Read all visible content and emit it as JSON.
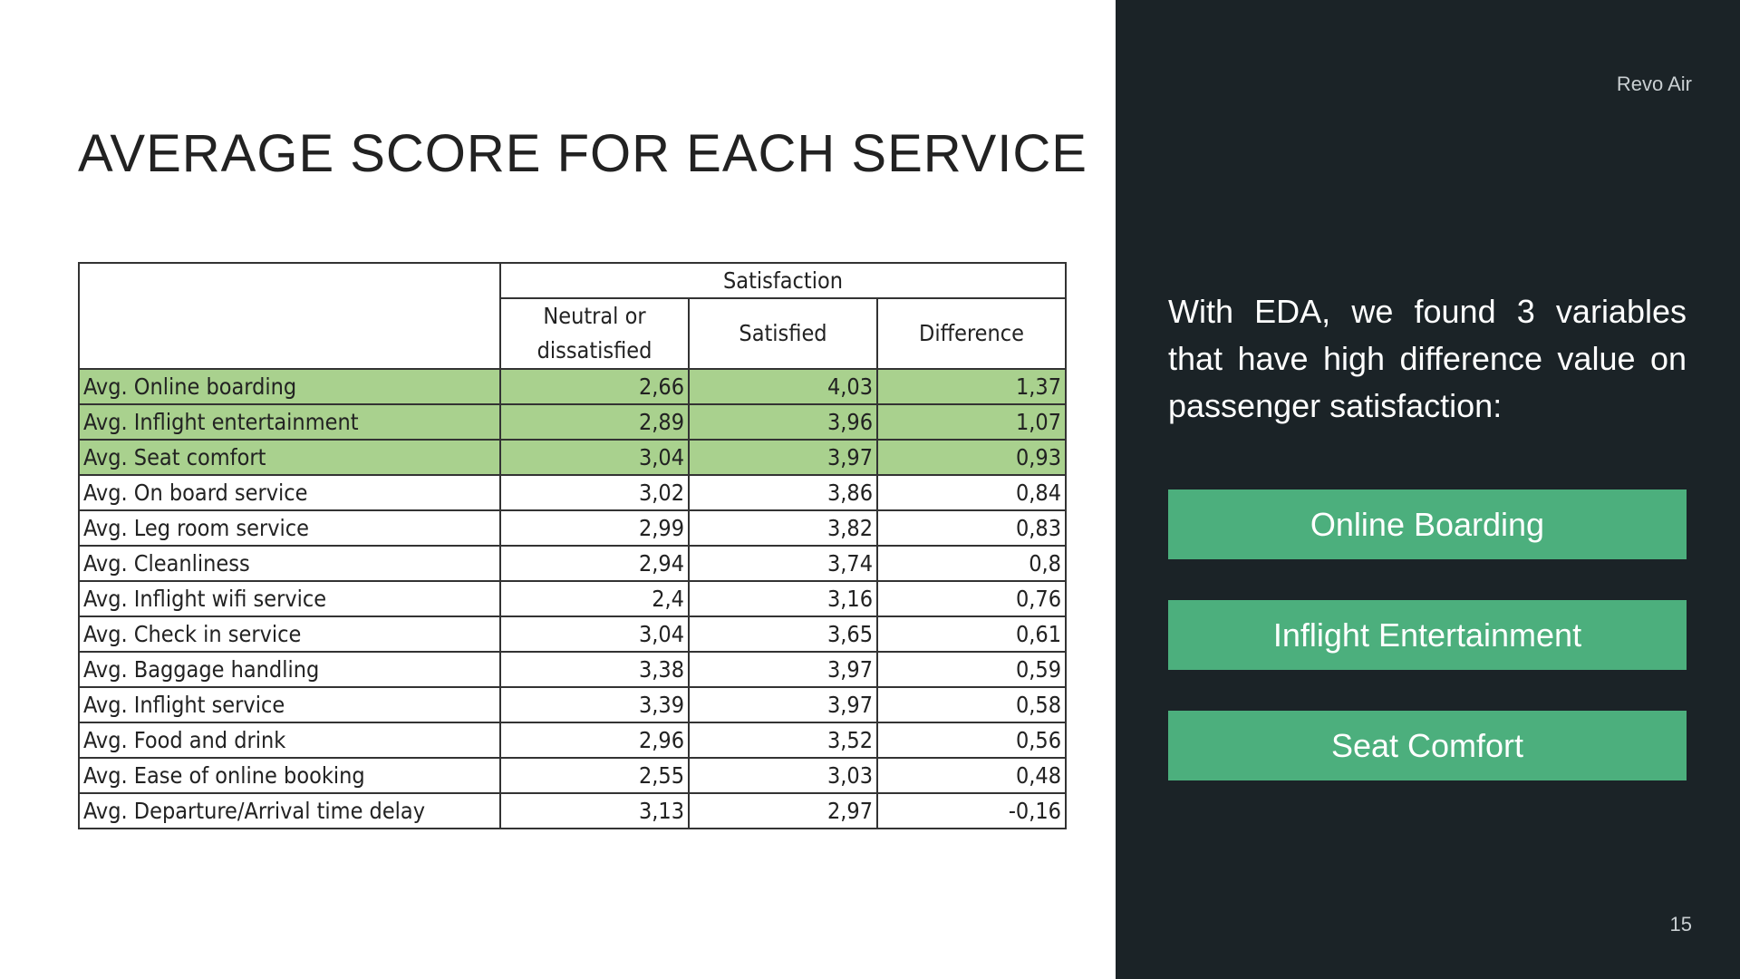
{
  "slide": {
    "title": "AVERAGE SCORE FOR EACH SERVICE",
    "brand": "Revo Air",
    "page_number": "15"
  },
  "table": {
    "group_header": "Satisfaction",
    "columns": [
      "Neutral or dissatisfied",
      "Satisfied",
      "Difference"
    ],
    "highlight_color": "#a9d18e",
    "rows": [
      {
        "label": "Avg. Online boarding",
        "neutral": "2,66",
        "satisfied": "4,03",
        "difference": "1,37",
        "highlighted": true
      },
      {
        "label": "Avg. Inflight entertainment",
        "neutral": "2,89",
        "satisfied": "3,96",
        "difference": "1,07",
        "highlighted": true
      },
      {
        "label": "Avg. Seat comfort",
        "neutral": "3,04",
        "satisfied": "3,97",
        "difference": "0,93",
        "highlighted": true
      },
      {
        "label": "Avg. On board service",
        "neutral": "3,02",
        "satisfied": "3,86",
        "difference": "0,84",
        "highlighted": false
      },
      {
        "label": "Avg. Leg room service",
        "neutral": "2,99",
        "satisfied": "3,82",
        "difference": "0,83",
        "highlighted": false
      },
      {
        "label": "Avg. Cleanliness",
        "neutral": "2,94",
        "satisfied": "3,74",
        "difference": "0,8",
        "highlighted": false
      },
      {
        "label": "Avg. Inflight wifi service",
        "neutral": "2,4",
        "satisfied": "3,16",
        "difference": "0,76",
        "highlighted": false
      },
      {
        "label": "Avg. Check in service",
        "neutral": "3,04",
        "satisfied": "3,65",
        "difference": "0,61",
        "highlighted": false
      },
      {
        "label": "Avg. Baggage handling",
        "neutral": "3,38",
        "satisfied": "3,97",
        "difference": "0,59",
        "highlighted": false
      },
      {
        "label": "Avg. Inflight service",
        "neutral": "3,39",
        "satisfied": "3,97",
        "difference": "0,58",
        "highlighted": false
      },
      {
        "label": "Avg. Food and drink",
        "neutral": "2,96",
        "satisfied": "3,52",
        "difference": "0,56",
        "highlighted": false
      },
      {
        "label": "Avg. Ease of online booking",
        "neutral": "2,55",
        "satisfied": "3,03",
        "difference": "0,48",
        "highlighted": false
      },
      {
        "label": "Avg. Departure/Arrival time delay",
        "neutral": "3,13",
        "satisfied": "2,97",
        "difference": "-0,16",
        "highlighted": false
      }
    ]
  },
  "sidebar": {
    "paragraph": "With EDA, we found 3 variables that have high difference value on passenger satisfaction:",
    "buttons": [
      "Online Boarding",
      "Inflight Entertainment",
      "Seat Comfort"
    ],
    "background": "#1b2327",
    "button_color": "#4caf7d"
  }
}
